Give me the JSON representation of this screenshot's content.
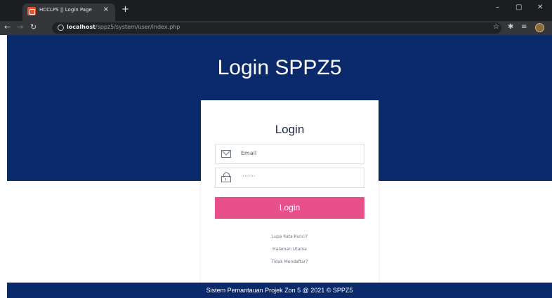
{
  "browser": {
    "tab_title": "HCCLPS || Login Page",
    "tab_close": "×",
    "new_tab": "+",
    "url_host": "localhost",
    "url_path": "/sppz5/system/user/index.php",
    "window_controls": [
      "–",
      "▢",
      "✕"
    ]
  },
  "page": {
    "title": "Login SPPZ5",
    "form": {
      "heading": "Login",
      "email_placeholder": "Email",
      "password_value": "········",
      "submit_label": "Login"
    },
    "links": [
      "Lupa Kata Kunci?",
      "Halaman Utama",
      "Tidak Mendaftar?"
    ],
    "footer": "Sistem Pemantauan Projek Zon 5 @ 2021 © SPPZ5"
  },
  "colors": {
    "primary": "#0a2a6b",
    "accent": "#e8508b"
  }
}
